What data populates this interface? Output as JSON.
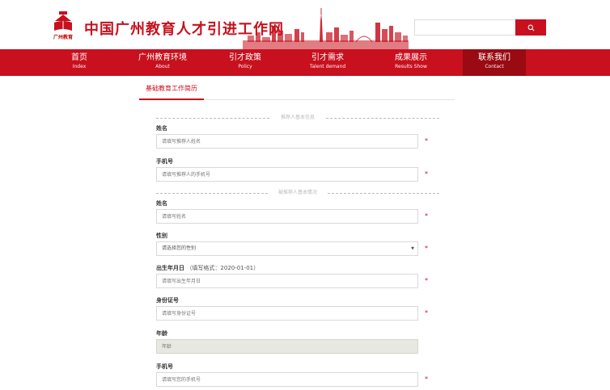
{
  "header": {
    "logo_text": "广州教育",
    "site_title": "中国广州教育人才引进工作网",
    "search_placeholder": "",
    "colors": {
      "brand_red": "#c8101e",
      "nav_active": "#9a0a12"
    }
  },
  "nav": {
    "items": [
      {
        "zh": "首页",
        "en": "Index"
      },
      {
        "zh": "广州教育环境",
        "en": "About"
      },
      {
        "zh": "引才政策",
        "en": "Policy"
      },
      {
        "zh": "引才需求",
        "en": "Talent demand"
      },
      {
        "zh": "成果展示",
        "en": "Results Show"
      },
      {
        "zh": "联系我们",
        "en": "Contact"
      }
    ],
    "active_index": 5
  },
  "tabs": {
    "active_label": "基础教育工作简历"
  },
  "form": {
    "section1_title": "推荐人基本信息",
    "section2_title": "被推荐人基本情况",
    "required_mark": "*",
    "recommender_name": {
      "label": "姓名",
      "placeholder": "请填写推荐人姓名"
    },
    "recommender_phone": {
      "label": "手机号",
      "placeholder": "请填写推荐人的手机号"
    },
    "name": {
      "label": "姓名",
      "placeholder": "请填写姓名"
    },
    "gender": {
      "label": "性别",
      "selected": "请选择您的性别"
    },
    "birthdate": {
      "label": "出生年月日",
      "hint": "（填写格式：2020-01-01）",
      "placeholder": "请填写出生年月日"
    },
    "id_number": {
      "label": "身份证号",
      "placeholder": "请填写身份证号"
    },
    "age": {
      "label": "年龄",
      "placeholder": "年龄"
    },
    "phone": {
      "label": "手机号",
      "placeholder": "请填写您的手机号"
    }
  },
  "icons": {
    "search": "search-icon",
    "select_arrow": "chevron-down-icon",
    "logo": "education-logo-icon",
    "skyline": "city-skyline-graphic"
  }
}
